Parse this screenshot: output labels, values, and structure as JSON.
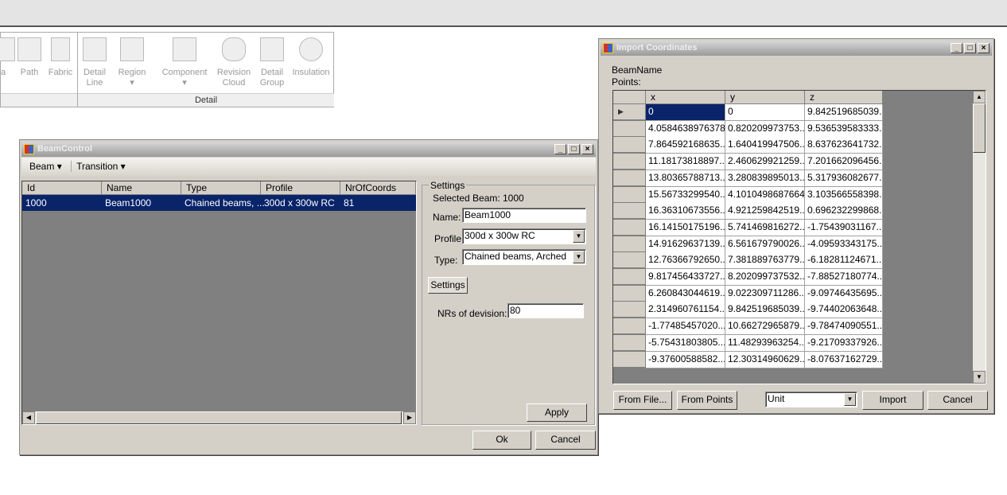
{
  "ribbon": {
    "buttons": [
      {
        "label": "ea"
      },
      {
        "label": "Path"
      },
      {
        "label": "Fabric"
      },
      {
        "label": "Detail Line"
      },
      {
        "label": "Region"
      },
      {
        "label": "Component"
      },
      {
        "label": "Revision Cloud"
      },
      {
        "label": "Detail Group"
      },
      {
        "label": "Insulation"
      }
    ],
    "group_label": "Detail"
  },
  "beam_control": {
    "title": "BeamControl",
    "menu": [
      "Beam",
      "Transition"
    ],
    "columns": [
      "Id",
      "Name",
      "Type",
      "Profile",
      "NrOfCoords"
    ],
    "rows": [
      [
        "1000",
        "Beam1000",
        "Chained beams, ...",
        "300d x 300w RC",
        "81"
      ]
    ],
    "settings": {
      "group_label": "Settings",
      "selected_beam_label": "Selected Beam:",
      "selected_beam_value": "1000",
      "name_label": "Name:",
      "name_value": "Beam1000",
      "profile_label": "Profile:",
      "profile_value": "300d x 300w RC",
      "type_label": "Type:",
      "type_value": "Chained beams, Arched",
      "tab_label": "Settings",
      "divisions_label": "NRs of devision:",
      "divisions_value": "80",
      "apply": "Apply"
    },
    "ok": "Ok",
    "cancel": "Cancel"
  },
  "import": {
    "title": "Import Coordinates",
    "beam_name_label": "BeamName",
    "points_label": "Points:",
    "columns": [
      "x",
      "y",
      "z"
    ],
    "rows": [
      [
        "0",
        "0",
        "9.842519685039..."
      ],
      [
        "4.0584638976378",
        "0.820209973753...",
        "9.536539583333..."
      ],
      [
        "7.864592168635...",
        "1.640419947506...",
        "8.637623641732..."
      ],
      [
        "11.18173818897...",
        "2.460629921259...",
        "7.201662096456..."
      ],
      [
        "13.80365788713...",
        "3.280839895013...",
        "5.317936082677..."
      ],
      [
        "15.56733299540...",
        "4.1010498687664",
        "3.103566558398..."
      ],
      [
        "16.36310673556...",
        "4.921259842519...",
        "0.696232299868..."
      ],
      [
        "16.14150175196...",
        "5.741469816272...",
        "-1.75439031167..."
      ],
      [
        "14.91629637139...",
        "6.561679790026...",
        "-4.09593343175..."
      ],
      [
        "12.76366792650...",
        "7.381889763779...",
        "-6.18281124671..."
      ],
      [
        "9.817456433727...",
        "8.202099737532...",
        "-7.88527180774..."
      ],
      [
        "6.260843044619...",
        "9.022309711286...",
        "-9.09746435695..."
      ],
      [
        "2.314960761154...",
        "9.842519685039...",
        "-9.74402063648..."
      ],
      [
        "-1.77485457020...",
        "10.66272965879...",
        "-9.78474090551..."
      ],
      [
        "-5.75431803805...",
        "11.48293963254...",
        "-9.21709337926..."
      ],
      [
        "-9.37600588582...",
        "12.30314960629...",
        "-8.07637162729..."
      ]
    ],
    "from_file": "From File...",
    "from_points": "From Points",
    "unit_value": "Unit",
    "import_btn": "Import",
    "cancel": "Cancel"
  },
  "colors": {
    "selection": "#0a246a",
    "dialog": "#d4d0c8",
    "grid_bg": "#808080"
  }
}
